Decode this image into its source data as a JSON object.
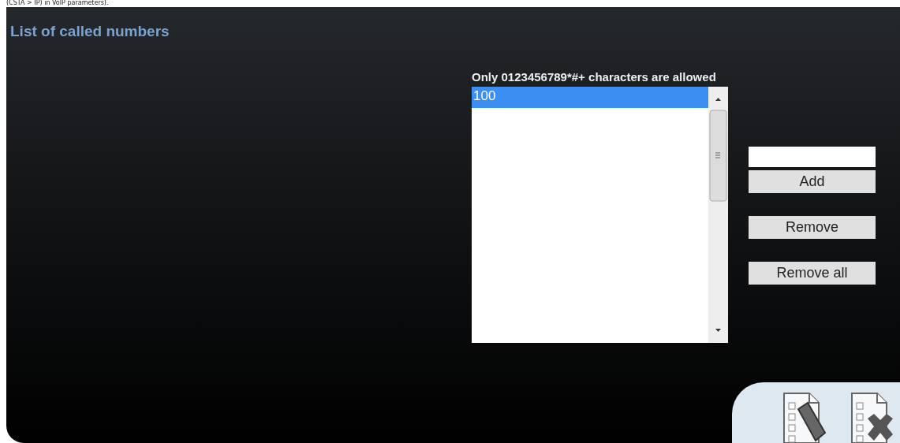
{
  "header_note": "(CSTA > IP) in VoIP parameters).",
  "section_title": "List of called numbers",
  "hint": "Only 0123456789*#+ characters are allowed",
  "numbers": [
    {
      "label": "100",
      "selected": true
    }
  ],
  "buttons": [
    {
      "label": "Add"
    },
    {
      "label": "Remove"
    },
    {
      "label": "Remove all"
    }
  ]
}
